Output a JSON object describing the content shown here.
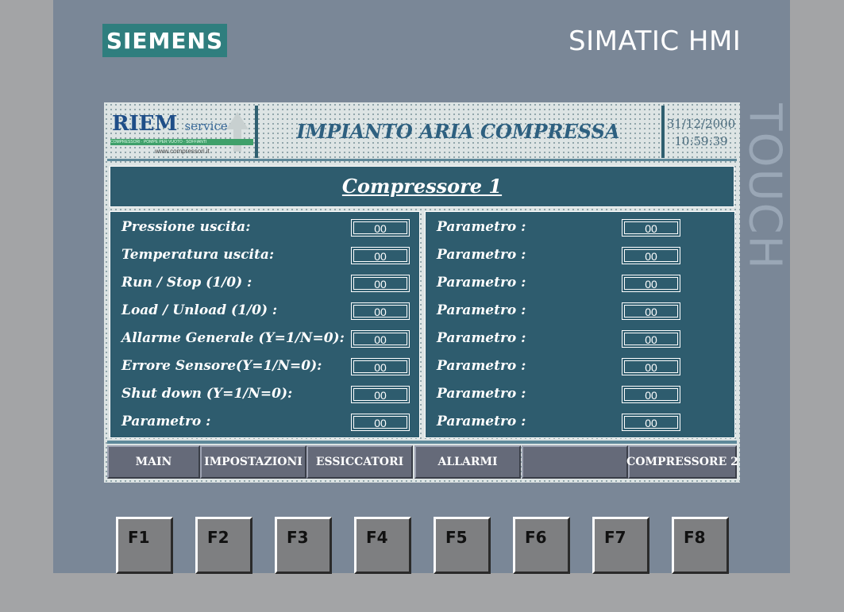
{
  "device": {
    "brand": "SIEMENS",
    "product": "SIMATIC HMI",
    "side_label": "TOUCH",
    "function_keys": [
      "F1",
      "F2",
      "F3",
      "F4",
      "F5",
      "F6",
      "F7",
      "F8"
    ]
  },
  "header": {
    "logo_name": "RIEM",
    "logo_suffix": "service",
    "logo_tagline": "COMPRESSORI · POMPE PER VUOTO · SOFFIANTI",
    "logo_website": "www.compressori.it",
    "title": "IMPIANTO ARIA COMPRESSA",
    "date": "31/12/2000",
    "time": "10:59:39"
  },
  "page_title": "Compressore 1",
  "left_params": [
    {
      "label": "Pressione uscita:",
      "value": "00"
    },
    {
      "label": "Temperatura uscita:",
      "value": "00"
    },
    {
      "label": "Run / Stop (1/0) :",
      "value": "00"
    },
    {
      "label": "Load / Unload (1/0) :",
      "value": "00"
    },
    {
      "label": "Allarme Generale (Y=1/N=0):",
      "value": "00"
    },
    {
      "label": "Errore Sensore(Y=1/N=0):",
      "value": "00"
    },
    {
      "label": "Shut down (Y=1/N=0):",
      "value": "00"
    },
    {
      "label": "Parametro :",
      "value": "00"
    }
  ],
  "right_params": [
    {
      "label": "Parametro :",
      "value": "00"
    },
    {
      "label": "Parametro :",
      "value": "00"
    },
    {
      "label": "Parametro :",
      "value": "00"
    },
    {
      "label": "Parametro :",
      "value": "00"
    },
    {
      "label": "Parametro :",
      "value": "00"
    },
    {
      "label": "Parametro :",
      "value": "00"
    },
    {
      "label": "Parametro :",
      "value": "00"
    },
    {
      "label": "Parametro :",
      "value": "00"
    }
  ],
  "nav_buttons": [
    "MAIN",
    "IMPOSTAZIONI",
    "ESSICCATORI",
    "ALLARMI",
    "",
    "COMPRESSORE 2"
  ],
  "colors": {
    "panel": "#2e5c6e",
    "title_text": "#2e6080",
    "brand": "#2f7e7e",
    "bezel": "#7a8797"
  }
}
